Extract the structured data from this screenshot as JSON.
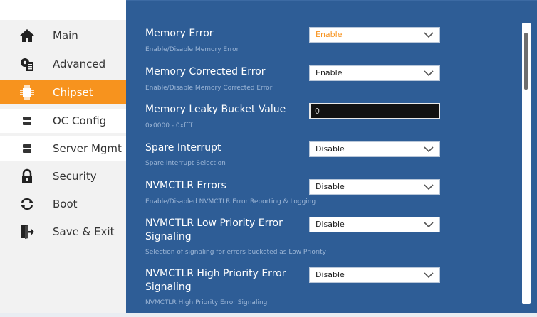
{
  "colors": {
    "accent": "#f7931e",
    "panel": "#2e5d96",
    "sidebar": "#f2f2f2"
  },
  "sidebar": {
    "items": [
      {
        "label": "Main",
        "icon": "home-icon"
      },
      {
        "label": "Advanced",
        "icon": "settings-doc-icon"
      },
      {
        "label": "Chipset",
        "icon": "chip-icon",
        "active": true
      },
      {
        "label": "OC Config",
        "icon": "server-icon"
      },
      {
        "label": "Server Mgmt",
        "icon": "server-icon"
      },
      {
        "label": "Security",
        "icon": "lock-icon"
      },
      {
        "label": "Boot",
        "icon": "reload-icon"
      },
      {
        "label": "Save & Exit",
        "icon": "exit-icon"
      }
    ]
  },
  "settings": [
    {
      "title": "Memory Error",
      "help": "Enable/Disable Memory Error",
      "type": "select",
      "value": "Enable",
      "highlighted": true
    },
    {
      "title": "Memory Corrected Error",
      "help": "Enable/Disable Memory Corrected Error",
      "type": "select",
      "value": "Enable"
    },
    {
      "title": "Memory Leaky Bucket Value",
      "help": "0x0000 - 0xffff",
      "type": "input",
      "value": "0"
    },
    {
      "title": "Spare Interrupt",
      "help": "Spare Interrupt Selection",
      "type": "select",
      "value": "Disable"
    },
    {
      "title": "NVMCTLR Errors",
      "help": "Enable/Disabled NVMCTLR Error Reporting & Logging",
      "type": "select",
      "value": "Disable"
    },
    {
      "title_line1": "NVMCTLR Low Priority Error",
      "title_line2": "Signaling",
      "help": "Selection of signaling for errors bucketed as Low Priority",
      "type": "select",
      "value": "Disable"
    },
    {
      "title_line1": "NVMCTLR High Priority Error",
      "title_line2": "Signaling",
      "help": "NVMCTLR High Priority Error Signaling",
      "type": "select",
      "value": "Disable"
    }
  ]
}
